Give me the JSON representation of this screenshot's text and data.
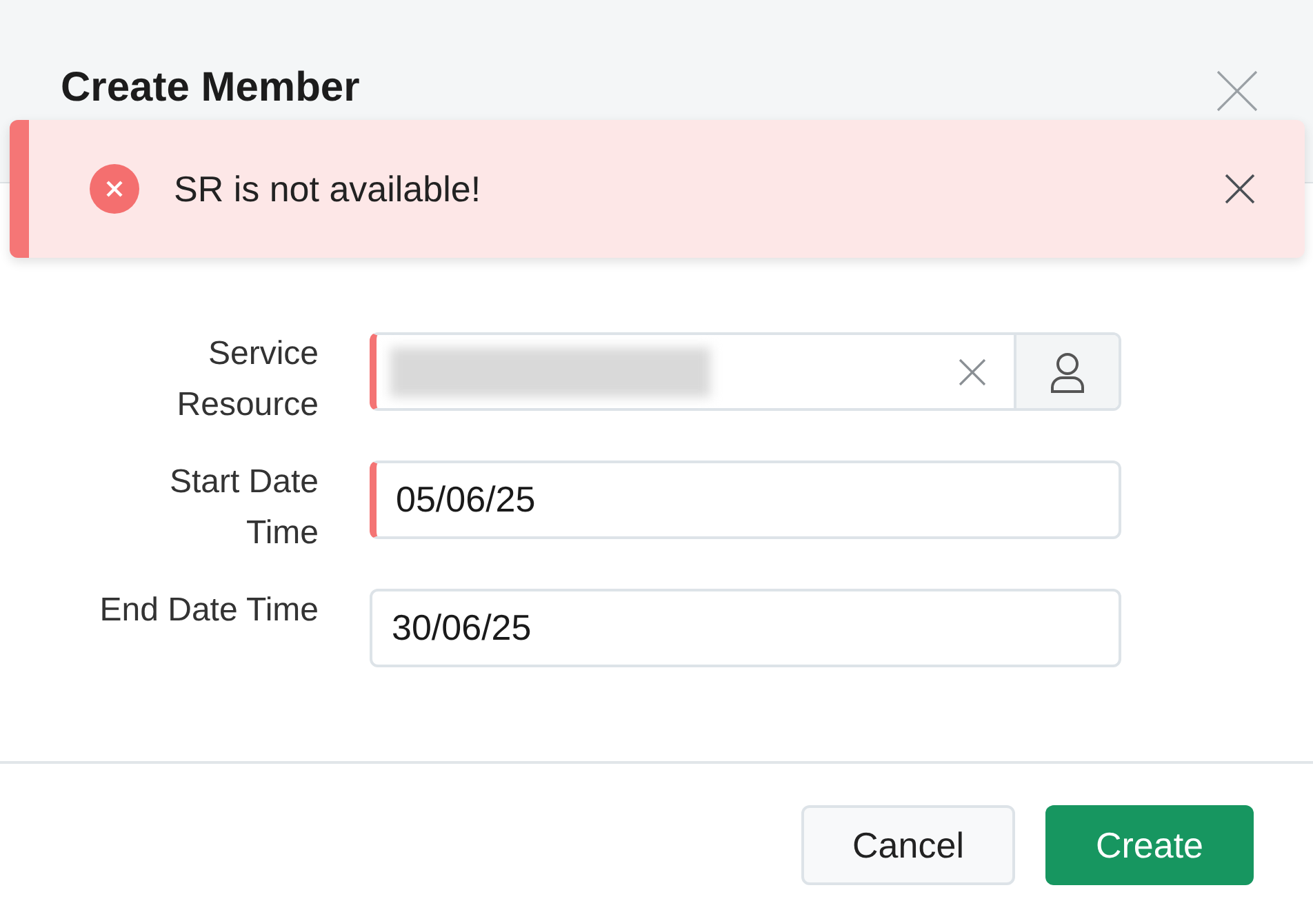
{
  "dialog": {
    "title": "Create Member"
  },
  "toast": {
    "kind": "error",
    "message": "SR is not available!"
  },
  "fields": [
    {
      "kind": "lookup",
      "label": [
        "Service",
        "Resource"
      ],
      "required": true
    },
    {
      "kind": "text",
      "label": [
        "Start Date",
        "Time"
      ],
      "required": true,
      "value": "05/06/25"
    },
    {
      "kind": "text",
      "label": [
        "End Date Time"
      ],
      "required": false,
      "value": "30/06/25"
    }
  ],
  "buttons": [
    {
      "label": "Cancel",
      "kind": "secondary"
    },
    {
      "label": "Create",
      "kind": "primary"
    }
  ]
}
